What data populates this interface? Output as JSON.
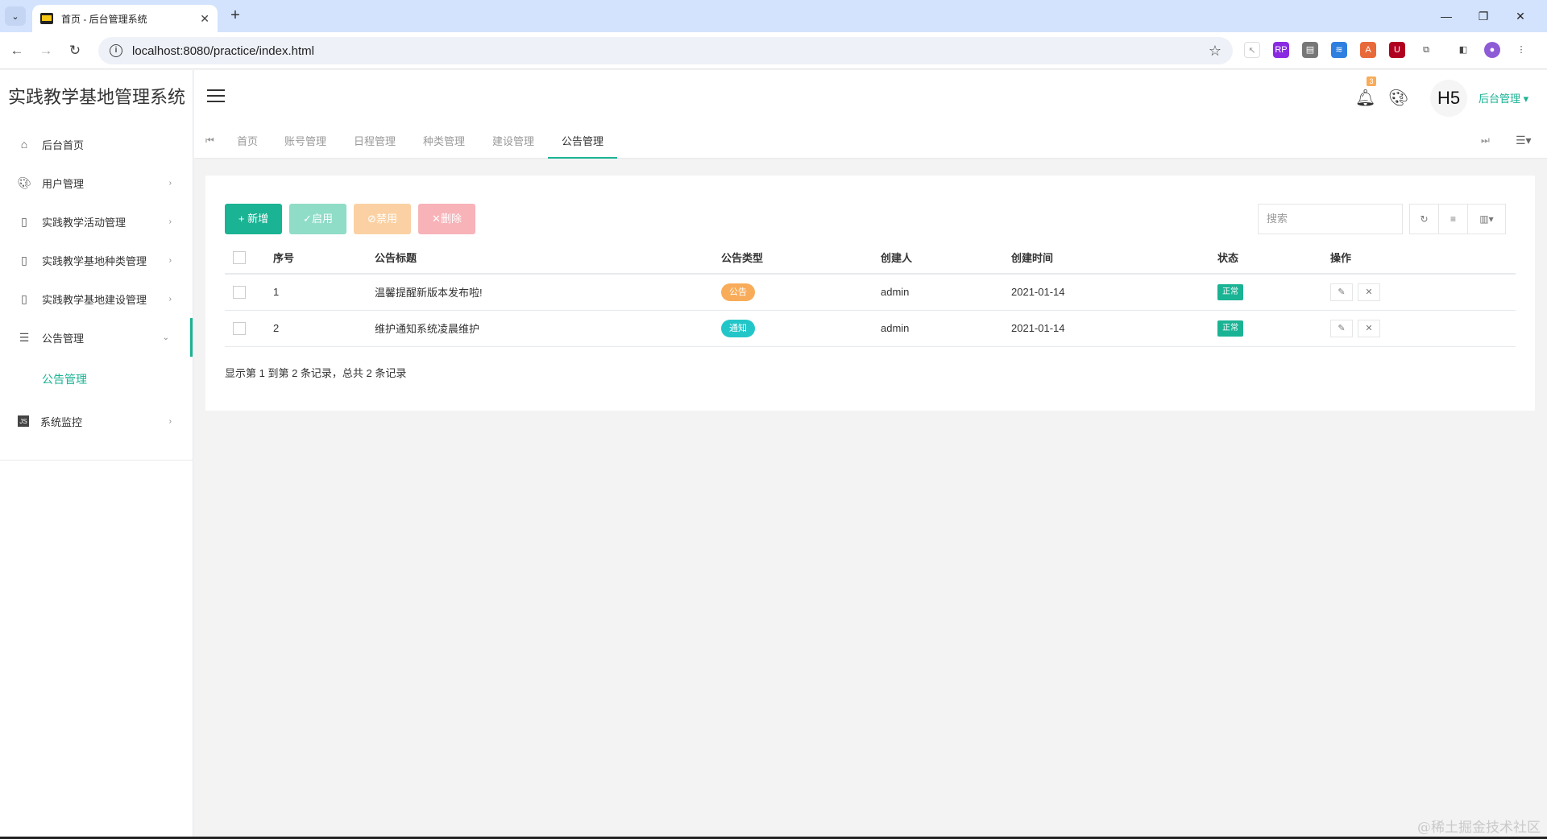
{
  "browser": {
    "tab_title": "首页 - 后台管理系统",
    "url": "localhost:8080/practice/index.html",
    "new_tab": "+",
    "close": "✕"
  },
  "app": {
    "logo": "实践教学基地管理系统",
    "user_avatar": "H5",
    "user_menu": "后台管理",
    "notification_count": "3"
  },
  "sidebar": {
    "items": [
      {
        "label": "后台首页",
        "icon": "home-icon",
        "arrow": ""
      },
      {
        "label": "用户管理",
        "icon": "palette-icon",
        "arrow": "›"
      },
      {
        "label": "实践教学活动管理",
        "icon": "file-icon",
        "arrow": "›"
      },
      {
        "label": "实践教学基地种类管理",
        "icon": "file-icon",
        "arrow": "›"
      },
      {
        "label": "实践教学基地建设管理",
        "icon": "file-icon",
        "arrow": "›"
      },
      {
        "label": "公告管理",
        "icon": "list-icon",
        "arrow": "⌄"
      },
      {
        "label": "系统监控",
        "icon": "js-icon",
        "arrow": "›"
      }
    ],
    "sub_item": "公告管理"
  },
  "page_tabs": [
    "首页",
    "账号管理",
    "日程管理",
    "种类管理",
    "建设管理",
    "公告管理"
  ],
  "toolbar": {
    "add": "+ 新增",
    "enable": "✓启用",
    "disable": "⊘禁用",
    "delete": "✕删除",
    "search_placeholder": "搜索"
  },
  "table": {
    "headers": [
      "序号",
      "公告标题",
      "公告类型",
      "创建人",
      "创建时间",
      "状态",
      "操作"
    ],
    "rows": [
      {
        "id": "1",
        "title": "温馨提醒新版本发布啦!",
        "type": "公告",
        "creator": "admin",
        "created": "2021-01-14",
        "status": "正常"
      },
      {
        "id": "2",
        "title": "维护通知系统凌晨维护",
        "type": "通知",
        "creator": "admin",
        "created": "2021-01-14",
        "status": "正常"
      }
    ]
  },
  "pager_text": "显示第 1 到第 2 条记录，总共 2 条记录",
  "watermark": "@稀土掘金技术社区",
  "colors": {
    "accent": "#1ab394",
    "type_notice": "#f8ac59",
    "type_inform": "#23c6c8"
  }
}
